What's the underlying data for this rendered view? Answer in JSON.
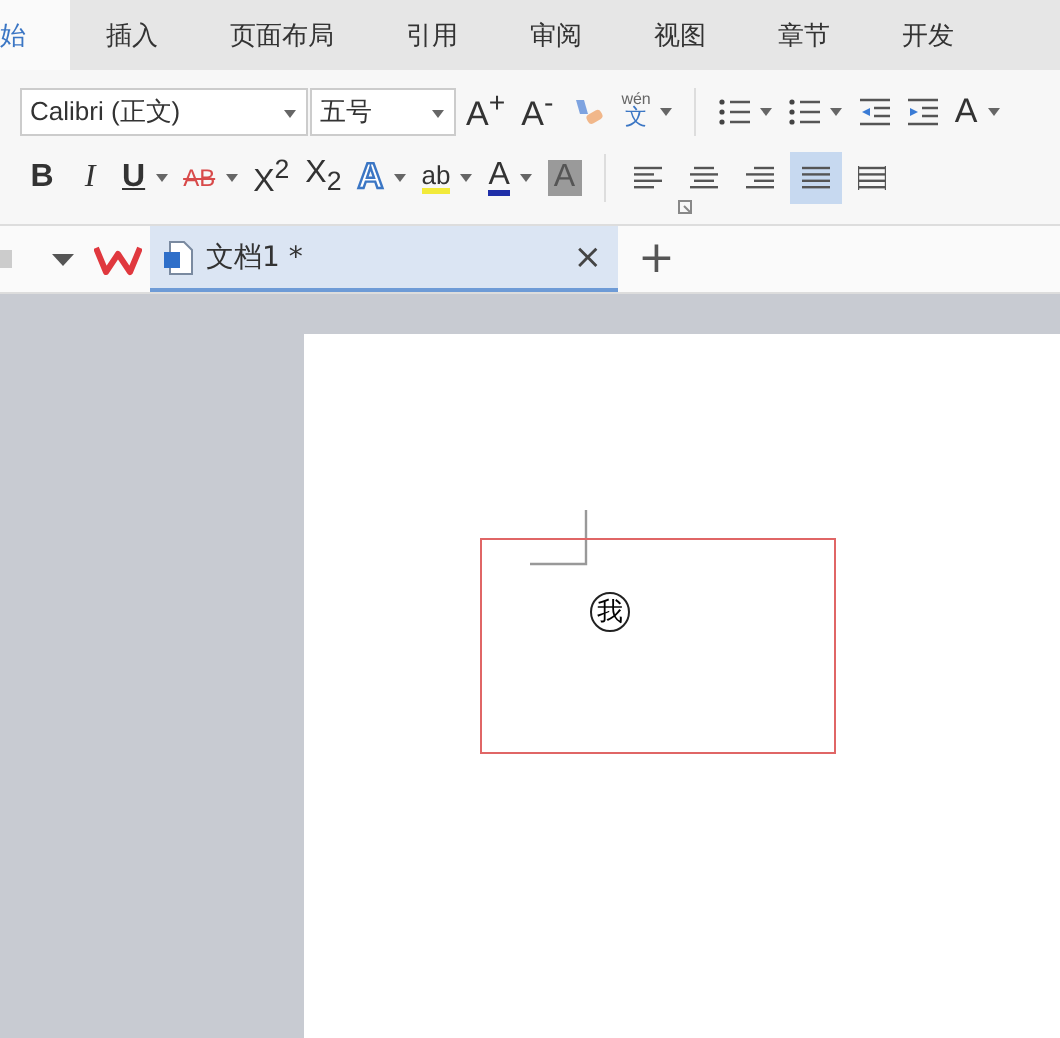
{
  "tabs": [
    {
      "label": "始",
      "selected": true
    },
    {
      "label": "插入",
      "selected": false
    },
    {
      "label": "页面布局",
      "selected": false
    },
    {
      "label": "引用",
      "selected": false
    },
    {
      "label": "审阅",
      "selected": false
    },
    {
      "label": "视图",
      "selected": false
    },
    {
      "label": "章节",
      "selected": false
    },
    {
      "label": "开发",
      "selected": false
    }
  ],
  "font": {
    "family": "Calibri (正文)",
    "size": "五号"
  },
  "row1": [
    {
      "kind": "grow",
      "label": "A$^{+}$",
      "caret": false
    },
    {
      "kind": "shrink",
      "label": "A$^{-}$",
      "caret": false
    },
    {
      "kind": "eraser",
      "caret": false
    },
    {
      "kind": "pinyin",
      "label": "wén",
      "sub": "文",
      "caret": true
    }
  ],
  "row1_para": [
    {
      "kind": "bullets",
      "caret": true
    },
    {
      "kind": "numbering",
      "caret": true
    },
    {
      "kind": "outdent",
      "caret": false
    },
    {
      "kind": "indent",
      "caret": false
    },
    {
      "kind": "case",
      "label": "A",
      "caret": true
    }
  ],
  "row2": [
    {
      "kind": "bold",
      "label": "B",
      "caret": false
    },
    {
      "kind": "italic",
      "label": "I",
      "caret": false
    },
    {
      "kind": "underline",
      "label": "U",
      "caret": true
    },
    {
      "kind": "strike",
      "label": "AB",
      "caret": true
    },
    {
      "kind": "sup",
      "label": "X$^{2}$",
      "caret": false
    },
    {
      "kind": "sub",
      "label": "X$_{2}$",
      "caret": false
    },
    {
      "kind": "outline",
      "label": "A",
      "caret": true
    },
    {
      "kind": "highlight",
      "label": "ab",
      "caret": true
    },
    {
      "kind": "fontcolor",
      "label": "A",
      "caret": true
    },
    {
      "kind": "shade",
      "label": "A",
      "caret": false
    }
  ],
  "alignment": [
    {
      "kind": "left",
      "selected": false
    },
    {
      "kind": "center",
      "selected": false
    },
    {
      "kind": "right",
      "selected": false
    },
    {
      "kind": "justify",
      "selected": true
    },
    {
      "kind": "distributed",
      "selected": false
    }
  ],
  "document_tab": {
    "title": "文档1 *",
    "close": "×",
    "new": "+"
  },
  "document": {
    "textbox_text": "我"
  }
}
